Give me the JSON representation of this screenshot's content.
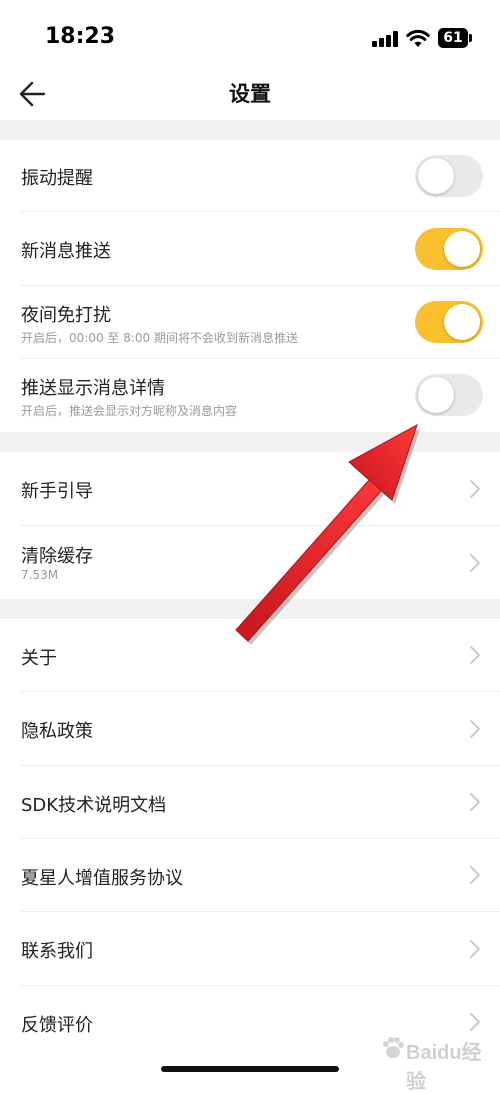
{
  "status_bar": {
    "time": "18:23",
    "battery": "61"
  },
  "header": {
    "title": "设置"
  },
  "toggle_section": [
    {
      "label": "振动提醒",
      "state": "off"
    },
    {
      "label": "新消息推送",
      "state": "on"
    },
    {
      "label": "夜间免打扰",
      "subtitle": "开启后，00:00 至 8:00 期间将不会收到新消息推送",
      "state": "on"
    },
    {
      "label": "推送显示消息详情",
      "subtitle": "开启后，推送会显示对方昵称及消息内容",
      "state": "off"
    }
  ],
  "nav_section_1": [
    {
      "label": "新手引导"
    },
    {
      "label": "清除缓存",
      "subtitle": "7.53M"
    }
  ],
  "nav_section_2": [
    {
      "label": "关于"
    },
    {
      "label": "隐私政策"
    },
    {
      "label": "SDK技术说明文档"
    },
    {
      "label": "夏星人增值服务协议"
    },
    {
      "label": "联系我们"
    },
    {
      "label": "反馈评价"
    }
  ],
  "colors": {
    "accent": "#fbc02d",
    "toggle_off": "#e9e9e9",
    "annotation_arrow": "#e8202a",
    "section_gap": "#f2f2f2"
  },
  "watermark": "Baidu经验"
}
